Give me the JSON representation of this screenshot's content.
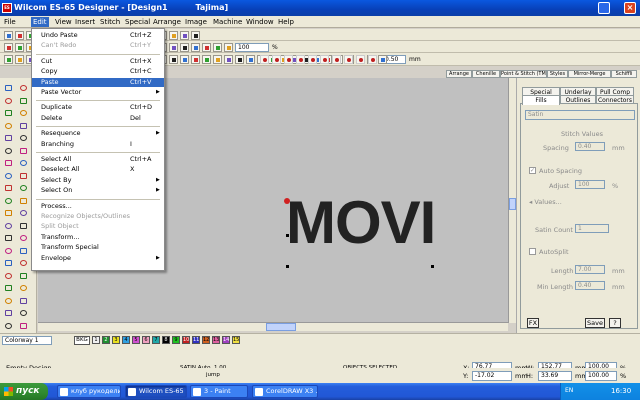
{
  "window": {
    "title": "Wilcom ES-65 Designer - [Design1          Tajima]"
  },
  "menubar": [
    "File",
    "Edit",
    "View",
    "Insert",
    "Stitch",
    "Special",
    "Arrange",
    "Image",
    "Machine",
    "Window",
    "Help"
  ],
  "edit_menu": [
    {
      "label": "Undo Paste",
      "shortcut": "Ctrl+Z",
      "state": "normal"
    },
    {
      "label": "Can't Redo",
      "shortcut": "Ctrl+Y",
      "state": "disabled"
    },
    {
      "sep": true
    },
    {
      "label": "Cut",
      "shortcut": "Ctrl+X",
      "state": "normal"
    },
    {
      "label": "Copy",
      "shortcut": "Ctrl+C",
      "state": "normal"
    },
    {
      "label": "Paste",
      "shortcut": "Ctrl+V",
      "state": "highlighted"
    },
    {
      "label": "Paste Vector",
      "shortcut": "",
      "state": "normal",
      "submenu": true
    },
    {
      "sep": true
    },
    {
      "label": "Duplicate",
      "shortcut": "Ctrl+D",
      "state": "normal"
    },
    {
      "label": "Delete",
      "shortcut": "Del",
      "state": "normal"
    },
    {
      "sep": true
    },
    {
      "label": "Resequence",
      "shortcut": "",
      "state": "normal",
      "submenu": true
    },
    {
      "label": "Branching",
      "shortcut": "I",
      "state": "normal"
    },
    {
      "sep": true
    },
    {
      "label": "Select All",
      "shortcut": "Ctrl+A",
      "state": "normal"
    },
    {
      "label": "Deselect All",
      "shortcut": "X",
      "state": "normal"
    },
    {
      "label": "Select By",
      "shortcut": "",
      "state": "normal",
      "submenu": true
    },
    {
      "label": "Select On",
      "shortcut": "",
      "state": "normal",
      "submenu": true
    },
    {
      "sep": true
    },
    {
      "label": "Process...",
      "shortcut": "",
      "state": "normal"
    },
    {
      "label": "Recognize Objects/Outlines",
      "shortcut": "",
      "state": "disabled"
    },
    {
      "label": "Split Object",
      "shortcut": "",
      "state": "disabled"
    },
    {
      "label": "Transform...",
      "shortcut": "",
      "state": "normal"
    },
    {
      "label": "Transform Special",
      "shortcut": "",
      "state": "normal"
    },
    {
      "label": "Envelope",
      "shortcut": "",
      "state": "normal",
      "submenu": true
    }
  ],
  "toolbar": {
    "zoom_value": "100",
    "percent": "%",
    "pitch_value": "0.50",
    "pitch_unit": "mm"
  },
  "top_tabs": [
    "Arrange",
    "Chenille",
    "Point & Stitch (TM)",
    "Styles",
    "Mirror-Merge",
    "Schiffli"
  ],
  "canvas": {
    "text": "MOVI"
  },
  "properties": {
    "tabs_row1": [
      "Special",
      "Underlay",
      "Pull Comp"
    ],
    "tabs_row2": [
      "Fills",
      "Outlines",
      "Connectors"
    ],
    "fill_type": "Satin",
    "stitch_values_label": "Stitch Values",
    "spacing_label": "Spacing",
    "spacing_value": "0.40",
    "spacing_unit": "mm",
    "auto_spacing_label": "Auto Spacing",
    "adjust_label": "Adjust",
    "adjust_value": "100",
    "adjust_unit": "%",
    "values_button": "Values...",
    "satin_count_label": "Satin Count",
    "satin_count_value": "1",
    "autosplit_label": "AutoSplit",
    "length_label": "Length",
    "length_value": "7.00",
    "length_unit": "mm",
    "minlength_label": "Min Length",
    "minlength_value": "0.40",
    "minlength_unit": "mm",
    "fx_button": "FX",
    "save_button": "Save",
    "help_button": "?"
  },
  "colorway": {
    "name": "Colorway 1",
    "bkg": "BKG",
    "swatches": [
      {
        "n": "1",
        "c": "#f0f0f0"
      },
      {
        "n": "2",
        "c": "#1f8f2f"
      },
      {
        "n": "3",
        "c": "#e8e020"
      },
      {
        "n": "4",
        "c": "#30a0e0"
      },
      {
        "n": "5",
        "c": "#d050d0"
      },
      {
        "n": "6",
        "c": "#f0a0c0"
      },
      {
        "n": "7",
        "c": "#20a8a8"
      },
      {
        "n": "8",
        "c": "#000000"
      },
      {
        "n": "9",
        "c": "#20c020"
      },
      {
        "n": "10",
        "c": "#c02020"
      },
      {
        "n": "11",
        "c": "#3030c0"
      },
      {
        "n": "12",
        "c": "#d06020"
      },
      {
        "n": "13",
        "c": "#e060a0"
      },
      {
        "n": "14",
        "c": "#a040c0"
      },
      {
        "n": "15",
        "c": "#f0e040"
      }
    ]
  },
  "status": {
    "empty_design": "Empty Design",
    "satin_auto": "SATIN Auto. 1.00",
    "objects_selected": "OBJECTS SELECTED",
    "jump": "jump",
    "x_label": "X:",
    "x_value": "76.77",
    "y_label": "Y:",
    "y_value": "-17.02",
    "w_label": "W:",
    "w_value": "152.77",
    "h_label": "H:",
    "h_value": "33.69",
    "mm": "mm",
    "pct1": "100.00",
    "pct2": "100.00",
    "pct": "%"
  },
  "taskbar": {
    "start": "пуск",
    "tasks": [
      "клуб рукодели...",
      "Wilcom ES-65 D...",
      "3 - Paint",
      "CorelDRAW X3 ..."
    ],
    "clock": "16:30",
    "lang": "EN"
  }
}
